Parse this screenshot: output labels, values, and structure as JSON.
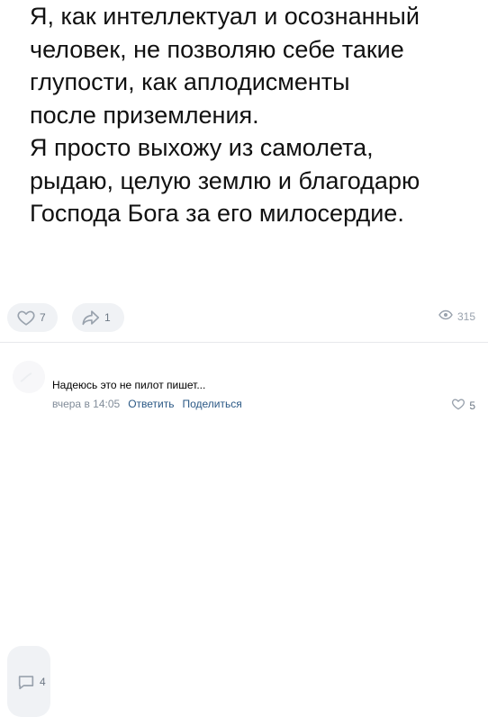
{
  "post": {
    "lines": [
      "Я, как интеллектуал и осознанный",
      "человек, не позволяю себе такие",
      "глупости, как аплодисменты",
      "после приземления.",
      "Я просто выхожу из самолета,",
      "рыдаю, целую землю и благодарю",
      "Господа Бога за его милосердие."
    ]
  },
  "actions": {
    "likes": "7",
    "comments": "4",
    "shares": "1",
    "views": "315"
  },
  "comment": {
    "author": "",
    "text": "Надеюсь это не пилот пишет...",
    "time": "вчера в 14:05",
    "reply_label": "Ответить",
    "share_label": "Поделиться",
    "likes": "5"
  },
  "colors": {
    "action_bg": "#f0f2f5",
    "icon": "#99a2ad",
    "link": "#2a5885",
    "meta": "#818c99"
  },
  "icons": {
    "like": "heart-icon",
    "comment": "comment-icon",
    "share": "share-icon",
    "views": "eye-icon",
    "comment_like": "heart-icon"
  }
}
